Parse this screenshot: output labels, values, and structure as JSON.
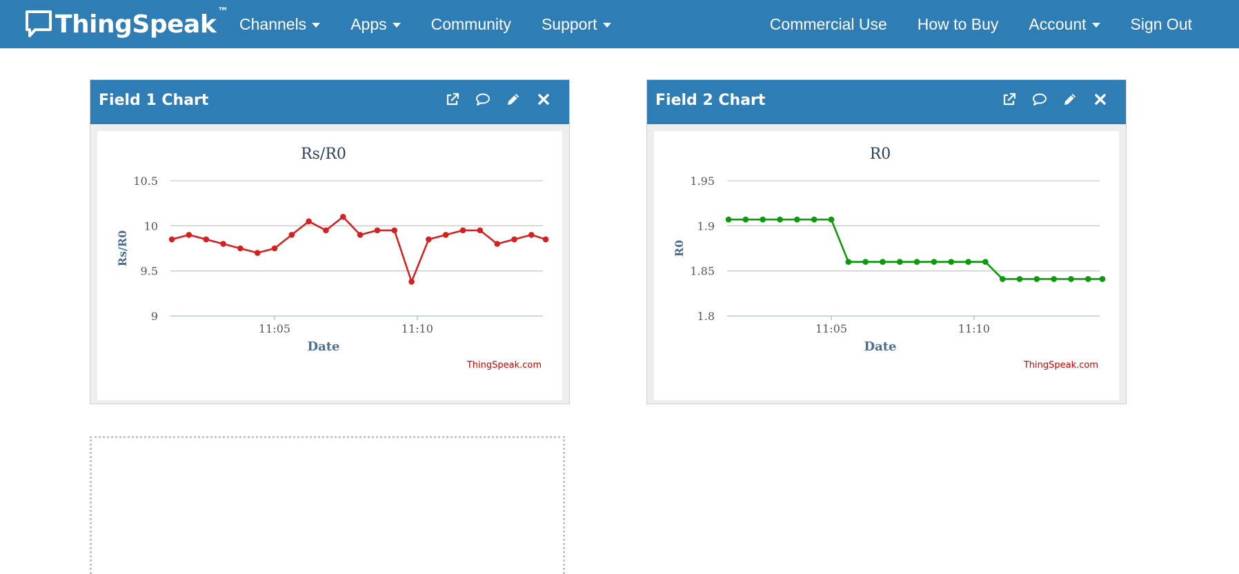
{
  "brand": {
    "name": "ThingSpeak",
    "tm": "™"
  },
  "nav": {
    "left": [
      {
        "label": "Channels",
        "caret": true,
        "active": true
      },
      {
        "label": "Apps",
        "caret": true,
        "active": false
      },
      {
        "label": "Community",
        "caret": false,
        "active": false
      },
      {
        "label": "Support",
        "caret": true,
        "active": false
      }
    ],
    "right": [
      {
        "label": "Commercial Use",
        "caret": false
      },
      {
        "label": "How to Buy",
        "caret": false
      },
      {
        "label": "Account",
        "caret": true
      },
      {
        "label": "Sign Out",
        "caret": false
      }
    ]
  },
  "colors": {
    "nav_bg": "#2e7db5",
    "nav_active": "#1a4a6e",
    "series1": "#d62020",
    "series2": "#0a9a0a",
    "credit": "#cc0000",
    "axis_title": "#4a6f93"
  },
  "widgets": [
    {
      "title": "Field 1 Chart"
    },
    {
      "title": "Field 2 Chart"
    }
  ],
  "tool_icons": [
    "external-link-icon",
    "comment-icon",
    "pencil-icon",
    "close-icon"
  ],
  "chart_data": [
    {
      "type": "line",
      "title": "Rs/R0",
      "xlabel": "Date",
      "ylabel": "Rs/R0",
      "credit": "ThingSpeak.com",
      "x_ticks": [
        "11:05",
        "11:10"
      ],
      "x_tick_minutes": [
        5,
        10
      ],
      "x_range_minutes": [
        1.35,
        14.5
      ],
      "x_minutes": [
        1.4,
        2.0,
        2.6,
        3.2,
        3.8,
        4.4,
        5.0,
        5.6,
        6.2,
        6.8,
        7.4,
        8.0,
        8.6,
        9.2,
        9.8,
        10.4,
        11.0,
        11.6,
        12.2,
        12.8,
        13.4,
        14.0,
        14.5
      ],
      "values": [
        9.85,
        9.9,
        9.85,
        9.8,
        9.75,
        9.7,
        9.75,
        9.9,
        10.05,
        9.95,
        10.1,
        9.9,
        9.95,
        9.95,
        9.38,
        9.85,
        9.9,
        9.95,
        9.95,
        9.8,
        9.85,
        9.9,
        9.85
      ],
      "y_ticks": [
        "10.5",
        "10",
        "9.5",
        "9"
      ],
      "ylim": [
        9,
        10.5
      ],
      "grid": true,
      "color": "#d62020"
    },
    {
      "type": "line",
      "title": "R0",
      "xlabel": "Date",
      "ylabel": "R0",
      "credit": "ThingSpeak.com",
      "x_ticks": [
        "11:05",
        "11:10"
      ],
      "x_tick_minutes": [
        5,
        10
      ],
      "x_range_minutes": [
        1.35,
        14.5
      ],
      "x_minutes": [
        1.4,
        2.0,
        2.6,
        3.2,
        3.8,
        4.4,
        5.0,
        5.6,
        6.2,
        6.8,
        7.4,
        8.0,
        8.6,
        9.2,
        9.8,
        10.4,
        11.0,
        11.6,
        12.2,
        12.8,
        13.4,
        14.0,
        14.5
      ],
      "values": [
        1.907,
        1.907,
        1.907,
        1.907,
        1.907,
        1.907,
        1.907,
        1.86,
        1.86,
        1.86,
        1.86,
        1.86,
        1.86,
        1.86,
        1.86,
        1.86,
        1.841,
        1.841,
        1.841,
        1.841,
        1.841,
        1.841,
        1.841
      ],
      "y_ticks": [
        "1.95",
        "1.9",
        "1.85",
        "1.8"
      ],
      "ylim": [
        1.8,
        1.95
      ],
      "grid": true,
      "color": "#0a9a0a"
    }
  ]
}
